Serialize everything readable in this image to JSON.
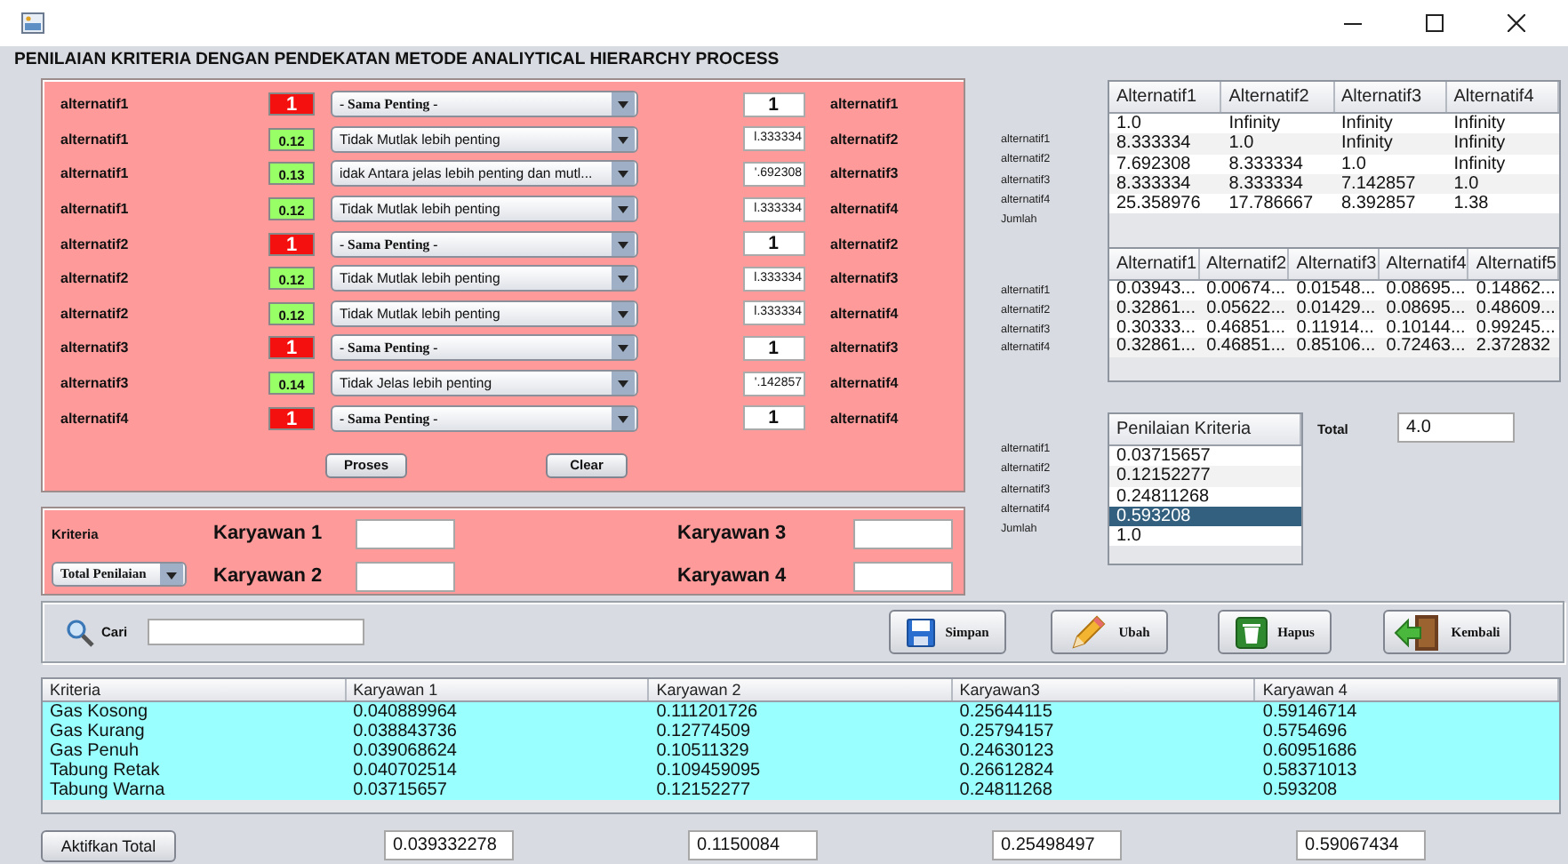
{
  "heading": "PENILAIAN KRITERIA DENGAN PENDEKATAN METODE ANALIYTICAL HIERARCHY PROCESS",
  "comparisons": [
    {
      "left": "alternatif1",
      "kind": "equal",
      "weight": "1",
      "choice": "- Sama Penting -",
      "value": "1",
      "right": "alternatif1"
    },
    {
      "left": "alternatif1",
      "kind": "weighted",
      "weight": "0.12",
      "choice": "Tidak Mutlak lebih penting",
      "value": "l.333334",
      "right": "alternatif2"
    },
    {
      "left": "alternatif1",
      "kind": "weighted",
      "weight": "0.13",
      "choice": "idak Antara jelas lebih penting dan mutl...",
      "value": "'.692308",
      "right": "alternatif3"
    },
    {
      "left": "alternatif1",
      "kind": "weighted",
      "weight": "0.12",
      "choice": "Tidak Mutlak lebih penting",
      "value": "l.333334",
      "right": "alternatif4"
    },
    {
      "left": "alternatif2",
      "kind": "equal",
      "weight": "1",
      "choice": "- Sama Penting -",
      "value": "1",
      "right": "alternatif2"
    },
    {
      "left": "alternatif2",
      "kind": "weighted",
      "weight": "0.12",
      "choice": "Tidak Mutlak lebih penting",
      "value": "l.333334",
      "right": "alternatif3"
    },
    {
      "left": "alternatif2",
      "kind": "weighted",
      "weight": "0.12",
      "choice": "Tidak Mutlak lebih penting",
      "value": "l.333334",
      "right": "alternatif4"
    },
    {
      "left": "alternatif3",
      "kind": "equal",
      "weight": "1",
      "choice": "- Sama Penting -",
      "value": "1",
      "right": "alternatif3"
    },
    {
      "left": "alternatif3",
      "kind": "weighted",
      "weight": "0.14",
      "choice": "Tidak Jelas lebih penting",
      "value": "'.142857",
      "right": "alternatif4"
    },
    {
      "left": "alternatif4",
      "kind": "equal",
      "weight": "1",
      "choice": "- Sama Penting -",
      "value": "1",
      "right": "alternatif4"
    }
  ],
  "panel_buttons": [
    "Proses",
    "Clear"
  ],
  "employee_panel": {
    "label": "Kriteria",
    "dropdown": "Total Penilaian",
    "fields": [
      "Karyawan 1",
      "Karyawan 3",
      "Karyawan 2",
      "Karyawan 4"
    ]
  },
  "matrix": {
    "row_labels": [
      "alternatif1",
      "alternatif2",
      "alternatif3",
      "alternatif4",
      "Jumlah"
    ],
    "columns": [
      "Alternatif1",
      "Alternatif2",
      "Alternatif3",
      "Alternatif4"
    ],
    "rows": [
      [
        "1.0",
        "Infinity",
        "Infinity",
        "Infinity"
      ],
      [
        "8.333334",
        "1.0",
        "Infinity",
        "Infinity"
      ],
      [
        "7.692308",
        "8.333334",
        "1.0",
        "Infinity"
      ],
      [
        "8.333334",
        "8.333334",
        "7.142857",
        "1.0"
      ],
      [
        "25.358976",
        "17.786667",
        "8.392857",
        "1.38"
      ]
    ]
  },
  "normalized": {
    "row_labels": [
      "alternatif1",
      "alternatif2",
      "alternatif3",
      "alternatif4"
    ],
    "columns": [
      "Alternatif1",
      "Alternatif2",
      "Alternatif3",
      "Alternatif4",
      "Alternatif5"
    ],
    "rows": [
      [
        "0.03943...",
        "0.00674...",
        "0.01548...",
        "0.08695...",
        "0.14862..."
      ],
      [
        "0.32861...",
        "0.05622...",
        "0.01429...",
        "0.08695...",
        "0.48609..."
      ],
      [
        "0.30333...",
        "0.46851...",
        "0.11914...",
        "0.10144...",
        "0.99245..."
      ],
      [
        "0.32861...",
        "0.46851...",
        "0.85106...",
        "0.72463...",
        "2.372832"
      ]
    ]
  },
  "priority": {
    "row_labels": [
      "alternatif1",
      "alternatif2",
      "alternatif3",
      "alternatif4",
      "Jumlah"
    ],
    "column": "Penilaian Kriteria",
    "rows": [
      {
        "value": "0.03715657",
        "selected": false
      },
      {
        "value": "0.12152277",
        "selected": false
      },
      {
        "value": "0.24811268",
        "selected": false
      },
      {
        "value": "0.593208",
        "selected": true
      },
      {
        "value": "1.0",
        "selected": false
      }
    ],
    "total_label": "Total",
    "total_value": "4.0"
  },
  "search": {
    "label": "Cari"
  },
  "actions": [
    {
      "label": "Simpan",
      "kind": "save"
    },
    {
      "label": "Ubah",
      "kind": "edit"
    },
    {
      "label": "Hapus",
      "kind": "delete"
    },
    {
      "label": "Kembali",
      "kind": "back"
    }
  ],
  "results": {
    "columns": [
      "Kriteria",
      "Karyawan 1",
      "Karyawan 2",
      "Karyawan3",
      "Karyawan 4"
    ],
    "rows": [
      [
        "Gas Kosong",
        "0.040889964",
        "0.111201726",
        "0.25644115",
        "0.59146714"
      ],
      [
        "Gas Kurang",
        "0.038843736",
        "0.12774509",
        "0.25794157",
        "0.5754696"
      ],
      [
        "Gas Penuh",
        "0.039068624",
        "0.10511329",
        "0.24630123",
        "0.60951686"
      ],
      [
        "Tabung Retak",
        "0.040702514",
        "0.109459095",
        "0.26612824",
        "0.58371013"
      ],
      [
        "Tabung Warna",
        "0.03715657",
        "0.12152277",
        "0.24811268",
        "0.593208"
      ]
    ]
  },
  "totals_button": "Aktifkan Total",
  "totals": [
    "0.039332278",
    "0.1150084",
    "0.25498497",
    "0.59067434"
  ]
}
